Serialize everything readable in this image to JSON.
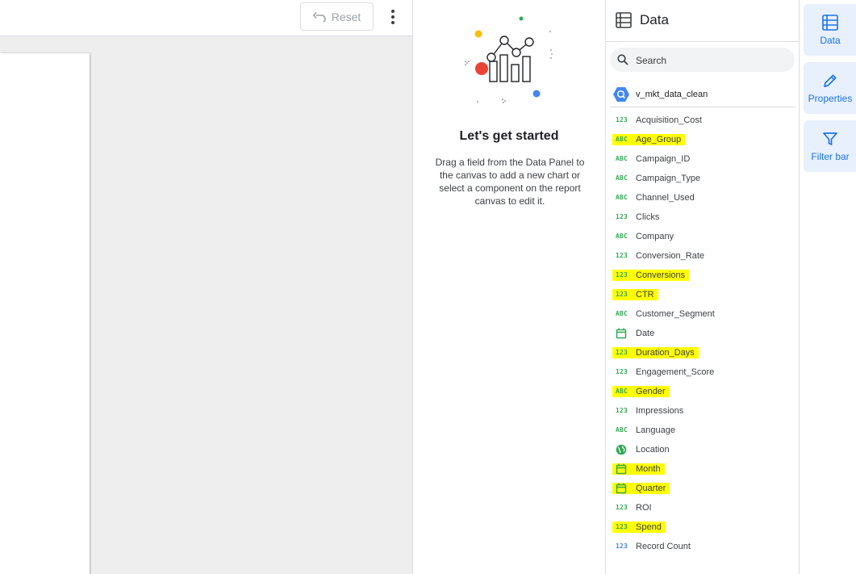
{
  "toolbar": {
    "reset_label": "Reset"
  },
  "properties": {
    "title": "Let's get started",
    "description": "Drag a field from the Data Panel to the canvas to add a new chart or select a component on the report canvas to edit it."
  },
  "data_panel": {
    "title": "Data",
    "search_placeholder": "Search",
    "datasource": "v_mkt_data_clean",
    "fields": [
      {
        "name": "Acquisition_Cost",
        "type": "number",
        "highlighted": false
      },
      {
        "name": "Age_Group",
        "type": "text",
        "highlighted": true
      },
      {
        "name": "Campaign_ID",
        "type": "text",
        "highlighted": false
      },
      {
        "name": "Campaign_Type",
        "type": "text",
        "highlighted": false
      },
      {
        "name": "Channel_Used",
        "type": "text",
        "highlighted": false
      },
      {
        "name": "Clicks",
        "type": "number",
        "highlighted": false
      },
      {
        "name": "Company",
        "type": "text",
        "highlighted": false
      },
      {
        "name": "Conversion_Rate",
        "type": "number",
        "highlighted": false
      },
      {
        "name": "Conversions",
        "type": "number",
        "highlighted": true
      },
      {
        "name": "CTR",
        "type": "number",
        "highlighted": true
      },
      {
        "name": "Customer_Segment",
        "type": "text",
        "highlighted": false
      },
      {
        "name": "Date",
        "type": "date",
        "highlighted": false
      },
      {
        "name": "Duration_Days",
        "type": "number",
        "highlighted": true
      },
      {
        "name": "Engagement_Score",
        "type": "number",
        "highlighted": false
      },
      {
        "name": "Gender",
        "type": "text",
        "highlighted": true
      },
      {
        "name": "Impressions",
        "type": "number",
        "highlighted": false
      },
      {
        "name": "Language",
        "type": "text",
        "highlighted": false
      },
      {
        "name": "Location",
        "type": "geo",
        "highlighted": false
      },
      {
        "name": "Month",
        "type": "date",
        "highlighted": true
      },
      {
        "name": "Quarter",
        "type": "date",
        "highlighted": true
      },
      {
        "name": "ROI",
        "type": "number",
        "highlighted": false
      },
      {
        "name": "Spend",
        "type": "number",
        "highlighted": true
      },
      {
        "name": "Record Count",
        "type": "record",
        "highlighted": false
      }
    ]
  },
  "right_rail": {
    "tabs": [
      {
        "label": "Data",
        "icon": "data-icon"
      },
      {
        "label": "Properties",
        "icon": "pencil-icon"
      },
      {
        "label": "Filter bar",
        "icon": "filter-icon"
      }
    ]
  },
  "colors": {
    "accent": "#1a73e8",
    "highlight": "#ffff00",
    "field_type_green": "#34a853",
    "record_blue": "#4285f4"
  }
}
